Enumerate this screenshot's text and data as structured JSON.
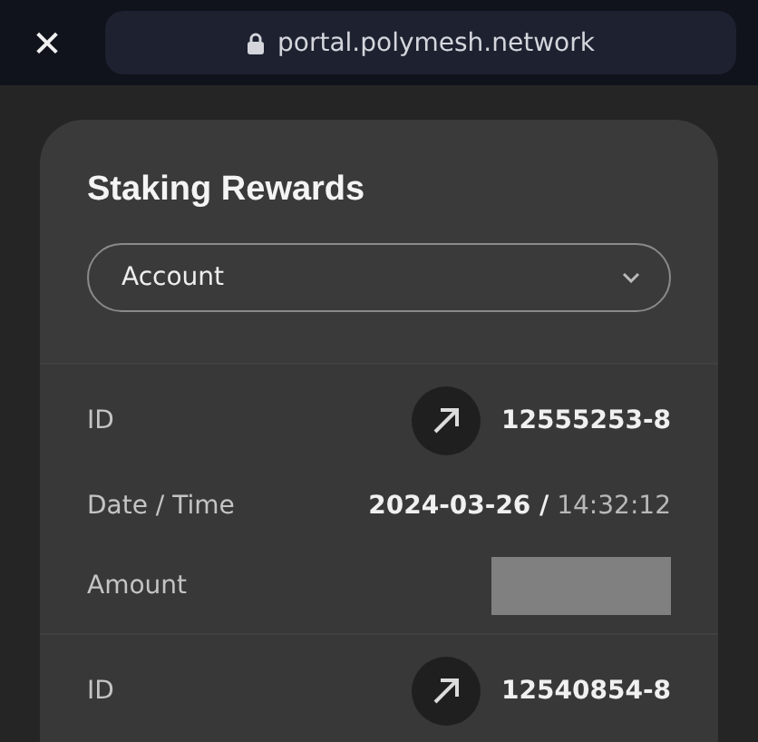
{
  "browser_bar": {
    "close": "✕",
    "url": "portal.polymesh.network"
  },
  "card": {
    "title": "Staking Rewards",
    "dropdown": {
      "value": "Account"
    },
    "records": [
      {
        "fields": [
          {
            "kind": "id",
            "label": "ID",
            "value": "12555253-8"
          },
          {
            "kind": "datetime",
            "label": "Date / Time",
            "value": "**2024-03-26 /** 14:32:12"
          },
          {
            "kind": "redacted",
            "label": "Amount"
          }
        ]
      },
      {
        "fields": [
          {
            "kind": "id",
            "label": "ID",
            "value": "12540854-8"
          }
        ]
      }
    ]
  }
}
